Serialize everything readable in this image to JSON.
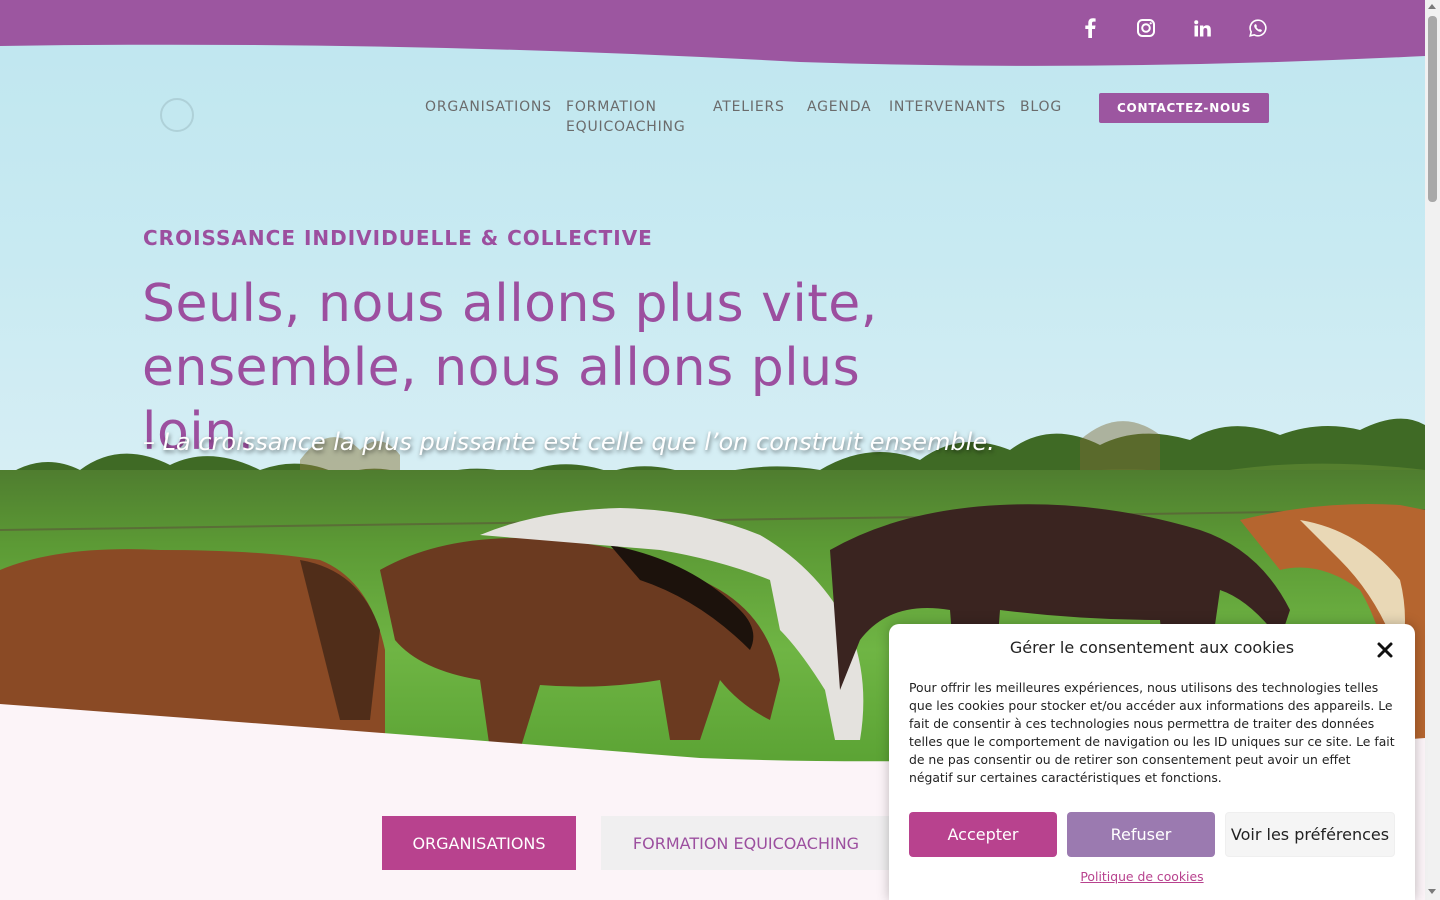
{
  "colors": {
    "brand_purple": "#9c56a0",
    "accent_magenta": "#b8428e",
    "muted_purple": "#9b7ab0",
    "nav_text": "#6b6b6b"
  },
  "socials": [
    {
      "icon": "facebook-icon"
    },
    {
      "icon": "instagram-icon"
    },
    {
      "icon": "linkedin-icon"
    },
    {
      "icon": "whatsapp-icon"
    }
  ],
  "nav": {
    "items": [
      {
        "label": "ORGANISATIONS"
      },
      {
        "label": "FORMATION EQUICOACHING"
      },
      {
        "label": "ATELIERS"
      },
      {
        "label": "AGENDA"
      },
      {
        "label": "INTERVENANTS"
      },
      {
        "label": "BLOG"
      }
    ],
    "contact_label": "CONTACTEZ-NOUS"
  },
  "hero": {
    "kicker": "CROISSANCE INDIVIDUELLE & COLLECTIVE",
    "headline_line1": "Seuls, nous allons plus vite,",
    "headline_line2": "ensemble, nous allons plus loin.",
    "quote": "– La croissance la plus puissante est celle que l’on construit ensemble."
  },
  "tabs": [
    {
      "label": "ORGANISATIONS",
      "active": true
    },
    {
      "label": "FORMATION EQUICOACHING",
      "active": false
    }
  ],
  "cookie": {
    "title": "Gérer le consentement aux cookies",
    "body": "Pour offrir les meilleures expériences, nous utilisons des technologies telles que les cookies pour stocker et/ou accéder aux informations des appareils. Le fait de consentir à ces technologies nous permettra de traiter des données telles que le comportement de navigation ou les ID uniques sur ce site. Le fait de ne pas consentir ou de retirer son consentement peut avoir un effet négatif sur certaines caractéristiques et fonctions.",
    "accept_label": "Accepter",
    "refuse_label": "Refuser",
    "prefs_label": "Voir les préférences",
    "policy_label": "Politique de cookies"
  }
}
